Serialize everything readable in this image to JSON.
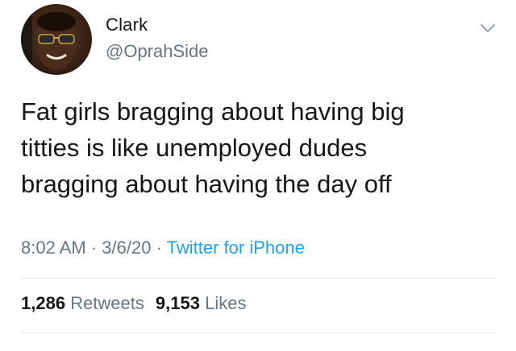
{
  "user": {
    "display_name": "Clark",
    "handle": "@OprahSide"
  },
  "tweet": {
    "lines": [
      "Fat girls bragging about having big",
      "titties is like unemployed dudes",
      "bragging about having the day off"
    ],
    "time": "8:02 AM",
    "date": "3/6/20",
    "separator": "·",
    "source": "Twitter for iPhone"
  },
  "stats": {
    "retweets_count": "1,286",
    "retweets_label": "Retweets",
    "likes_count": "9,153",
    "likes_label": "Likes"
  },
  "icons": {
    "menu": "chevron-down-icon"
  },
  "colors": {
    "text": "#14171a",
    "secondary": "#657786",
    "link": "#1da1f2",
    "divider": "#e1e8ed"
  }
}
